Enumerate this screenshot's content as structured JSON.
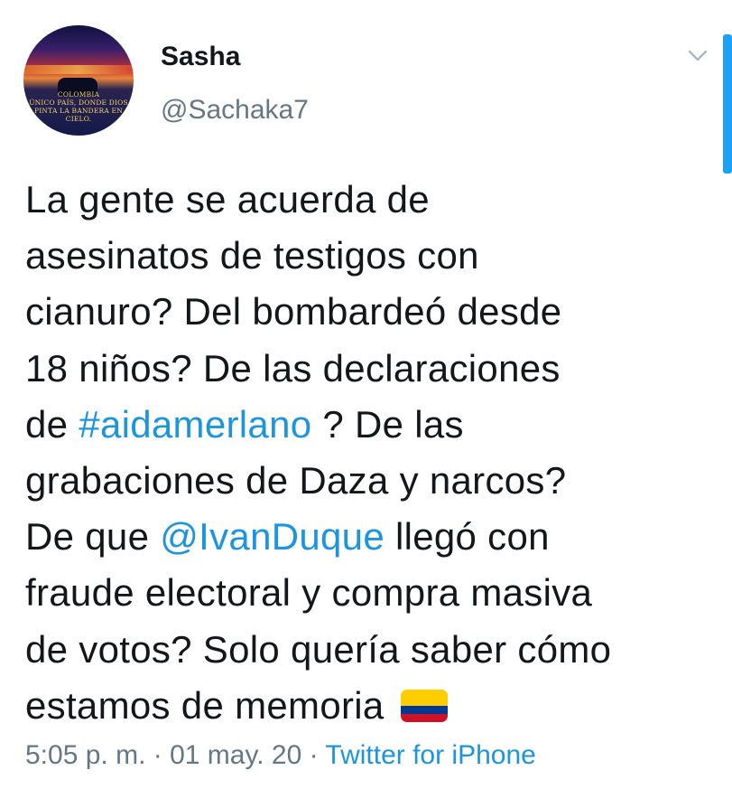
{
  "author": {
    "name": "Sasha",
    "handle": "@Sachaka7",
    "avatar_caption": "COLOMBIA\nÚNICO PAÍS, DONDE DIOS\nPINTA LA BANDERA EN\nCIELO."
  },
  "tweet": {
    "lines": [
      [
        "La gente se acuerda de"
      ],
      [
        "asesinatos de testigos con"
      ],
      [
        "cianuro? Del bombardeó desde"
      ],
      [
        "18 niños? De las declaraciones"
      ],
      [
        "de ",
        "#aidamerlano",
        " ? De las"
      ],
      [
        "grabaciones de Daza y narcos?"
      ],
      [
        "De que ",
        "@IvanDuque",
        " llegó con"
      ],
      [
        "fraude electoral y compra masiva"
      ],
      [
        "de votos? Solo quería saber cómo"
      ],
      [
        "estamos de memoria"
      ]
    ],
    "hashtag": "#aidamerlano",
    "mention": "@IvanDuque",
    "emoji": "colombia-flag-icon"
  },
  "meta": {
    "time": "5:05 p. m.",
    "separator": " · ",
    "date": "01 may. 20",
    "source": "Twitter for iPhone"
  },
  "colors": {
    "link": "#1b95e0",
    "text": "#14171a",
    "muted": "#657786",
    "scroll_indicator": "#1da1f2"
  },
  "icons": [
    "chevron-down-icon",
    "colombia-flag-icon"
  ]
}
